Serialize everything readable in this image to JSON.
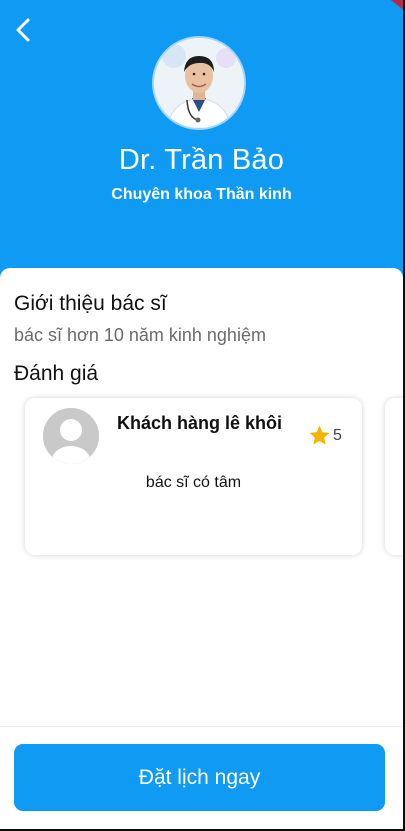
{
  "header": {
    "back_icon": "chevron-left-icon",
    "doctor_name": "Dr. Trần Bảo",
    "specialty": "Chuyên khoa Thần kinh"
  },
  "intro": {
    "title": "Giới thiệu bác sĩ",
    "text": "bác sĩ hơn 10 năm kinh nghiệm"
  },
  "reviews": {
    "title": "Đánh giá",
    "items": [
      {
        "name": "Khách hàng lê khôi",
        "rating": "5",
        "comment": "bác sĩ có tâm",
        "avatar_icon": "default-user-avatar"
      }
    ]
  },
  "booking": {
    "button_label": "Đặt lịch ngay"
  },
  "colors": {
    "primary": "#0f9af3",
    "star": "#f5b400"
  }
}
